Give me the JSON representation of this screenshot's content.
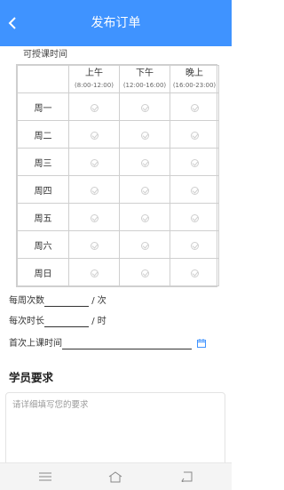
{
  "header": {
    "title": "发布订单"
  },
  "availability": {
    "label": "可授课时间",
    "columns": [
      {
        "label": "上午",
        "time": "(8:00-12:00)"
      },
      {
        "label": "下午",
        "time": "(12:00-16:00)"
      },
      {
        "label": "晚上",
        "time": "(16:00-23:00)"
      }
    ],
    "days": [
      "周一",
      "周二",
      "周三",
      "周四",
      "周五",
      "周六",
      "周日"
    ]
  },
  "form": {
    "weekly_count_label": "每周次数",
    "weekly_count_unit": "/ 次",
    "duration_label": "每次时长",
    "duration_unit": "/ 时",
    "first_class_label": "首次上课时间"
  },
  "requirements": {
    "title": "学员要求",
    "placeholder": "请详细填写您的要求"
  },
  "colors": {
    "primary": "#3f93ff"
  },
  "nav_icons": [
    "menu-icon",
    "home-icon",
    "back-icon"
  ]
}
